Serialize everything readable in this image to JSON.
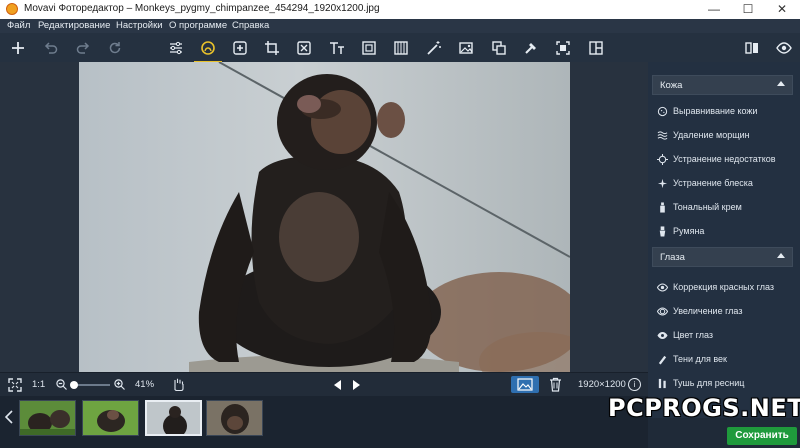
{
  "window": {
    "title": "Movavi Фоторедактор – Monkeys_pygmy_chimpanzee_454294_1920x1200.jpg",
    "minimize": "—",
    "maximize": "☐",
    "close": "✕"
  },
  "menu": [
    "Файл",
    "Редактирование",
    "Настройки",
    "О программе",
    "Справка"
  ],
  "toolbar": {
    "left_icons": [
      "plus-icon",
      "undo-icon",
      "redo-icon",
      "reset-icon"
    ],
    "tools": [
      "adjust-icon",
      "retouch-icon",
      "enhance-icon",
      "crop-icon",
      "object-removal-icon",
      "text-icon",
      "frame-icon",
      "filter-icon",
      "magic-wand-icon",
      "image-icon",
      "replace-background-icon",
      "stamp-icon",
      "select-icon",
      "split-icon"
    ],
    "active_tool": "retouch-icon",
    "right_icons": [
      "compare-icon",
      "preview-eye-icon"
    ]
  },
  "panel": {
    "sections": [
      {
        "title": "Кожа",
        "items": [
          {
            "label": "Выравнивание кожи",
            "icon": "skin-smooth-icon"
          },
          {
            "label": "Удаление морщин",
            "icon": "wrinkle-icon"
          },
          {
            "label": "Устранение недостатков",
            "icon": "blemish-icon"
          },
          {
            "label": "Устранение блеска",
            "icon": "shine-icon"
          },
          {
            "label": "Тональный крем",
            "icon": "foundation-icon"
          },
          {
            "label": "Румяна",
            "icon": "blush-icon"
          }
        ]
      },
      {
        "title": "Глаза",
        "items": [
          {
            "label": "Коррекция красных глаз",
            "icon": "red-eye-icon"
          },
          {
            "label": "Увеличение глаз",
            "icon": "eye-enlarge-icon"
          },
          {
            "label": "Цвет глаз",
            "icon": "eye-color-icon"
          },
          {
            "label": "Тени для век",
            "icon": "eyeshadow-icon"
          },
          {
            "label": "Тушь для ресниц",
            "icon": "mascara-icon"
          }
        ]
      }
    ]
  },
  "status": {
    "ratio": "1:1",
    "zoom": "41%",
    "zoom_level": 0.08,
    "dimensions": "1920×1200",
    "info": "i"
  },
  "filmstrip": {
    "count": 4,
    "selected": 2
  },
  "save_label": "Сохранить",
  "watermark": "PCPROGS.NET",
  "colors": {
    "accent": "#e8c12b",
    "save": "#1f9a3c",
    "panel_bg": "#233041"
  }
}
